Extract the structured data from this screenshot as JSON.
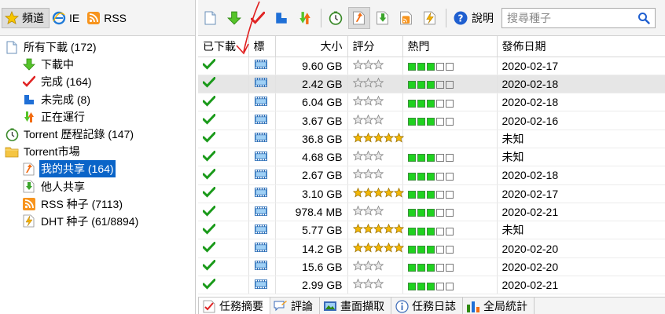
{
  "left_tabs": [
    {
      "label": "頻道",
      "icon": "star-icon",
      "active": true
    },
    {
      "label": "IE",
      "icon": "ie-icon",
      "active": false
    },
    {
      "label": "RSS",
      "icon": "rss-icon",
      "active": false
    }
  ],
  "tree": {
    "all_downloads": "所有下載 (172)",
    "downloading": "下載中",
    "completed": "完成 (164)",
    "incomplete": "未完成 (8)",
    "running": "正在運行",
    "history": "Torrent 歷程記錄 (147)",
    "market": "Torrent市場",
    "my_shares": "我的共享 (164)",
    "others_shares": "他人共享",
    "rss_seeds": "RSS 种子 (7113)",
    "dht_seeds": "DHT 种子 (61/8894)"
  },
  "toolbar": {
    "help_label": "說明",
    "search_placeholder": "搜尋種子"
  },
  "table": {
    "headers": {
      "downloaded": "已下載",
      "tag": "標",
      "size": "大小",
      "rating": "評分",
      "hot": "熱門",
      "date": "發佈日期"
    },
    "rows": [
      {
        "size": "9.60 GB",
        "stars": 0,
        "heat": 3,
        "date": "2020-02-17"
      },
      {
        "size": "2.42 GB",
        "stars": 0,
        "heat": 3,
        "date": "2020-02-18"
      },
      {
        "size": "6.04 GB",
        "stars": 0,
        "heat": 3,
        "date": "2020-02-18"
      },
      {
        "size": "3.67 GB",
        "stars": 0,
        "heat": 3,
        "date": "2020-02-16"
      },
      {
        "size": "36.8 GB",
        "stars": 5,
        "heat": 0,
        "date": "未知"
      },
      {
        "size": "4.68 GB",
        "stars": 0,
        "heat": 3,
        "date": "未知"
      },
      {
        "size": "2.67 GB",
        "stars": 0,
        "heat": 3,
        "date": "2020-02-18"
      },
      {
        "size": "3.10 GB",
        "stars": 5,
        "heat": 3,
        "date": "2020-02-17"
      },
      {
        "size": "978.4 MB",
        "stars": 0,
        "heat": 3,
        "date": "2020-02-21"
      },
      {
        "size": "5.77 GB",
        "stars": 5,
        "heat": 3,
        "date": "未知"
      },
      {
        "size": "14.2 GB",
        "stars": 5,
        "heat": 3,
        "date": "2020-02-20"
      },
      {
        "size": "15.6 GB",
        "stars": 0,
        "heat": 3,
        "date": "2020-02-20"
      },
      {
        "size": "2.99 GB",
        "stars": 0,
        "heat": 3,
        "date": "2020-02-21"
      }
    ],
    "selected_row": 1
  },
  "bottom_tabs": [
    {
      "label": "任務摘要",
      "icon": "summary-icon",
      "active": true
    },
    {
      "label": "評論",
      "icon": "comment-icon",
      "active": false
    },
    {
      "label": "畫面擷取",
      "icon": "screenshot-icon",
      "active": false
    },
    {
      "label": "任務日誌",
      "icon": "info-icon",
      "active": false
    },
    {
      "label": "全局統計",
      "icon": "stats-icon",
      "active": false
    }
  ],
  "colors": {
    "selection": "#0a64c8",
    "heat_on": "#1fd21f",
    "check": "#1a9a1a",
    "star_gold": "#f2b705",
    "annotation": "#e02020"
  }
}
